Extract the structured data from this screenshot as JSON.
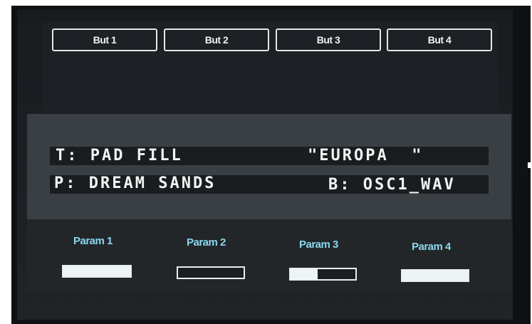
{
  "buttons": [
    {
      "label": "But 1"
    },
    {
      "label": "But 2"
    },
    {
      "label": "But 3"
    },
    {
      "label": "But 4"
    }
  ],
  "display": {
    "tone_line": "T: PAD FILL",
    "tone_name": "\"EUROPA  \"",
    "patch_line": "P: DREAM SANDS",
    "bank_line": "B: OSC1_WAV"
  },
  "params": [
    {
      "label": "Param 1",
      "level": 1.0
    },
    {
      "label": "Param 2",
      "level": 0.0
    },
    {
      "label": "Param 3",
      "level": 0.42
    },
    {
      "label": "Param 4",
      "level": 1.0
    }
  ],
  "colors": {
    "param_label": "#8ad7ee",
    "lcd_text": "#f3f4f2",
    "bar_border": "#e8eeef"
  }
}
